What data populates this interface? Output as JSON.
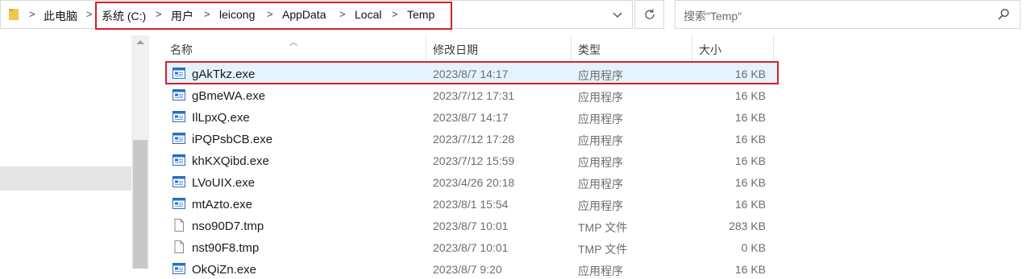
{
  "breadcrumb": {
    "items": [
      {
        "label": "此电脑"
      },
      {
        "label": "系统 (C:)"
      },
      {
        "label": "用户"
      },
      {
        "label": "leicong"
      },
      {
        "label": "AppData"
      },
      {
        "label": "Local"
      },
      {
        "label": "Temp"
      }
    ],
    "separator": ">"
  },
  "search": {
    "placeholder": "搜索\"Temp\""
  },
  "columns": {
    "name": "名称",
    "date": "修改日期",
    "type": "类型",
    "size": "大小"
  },
  "files": [
    {
      "name": "gAkTkz.exe",
      "date": "2023/8/7 14:17",
      "type": "应用程序",
      "size": "16 KB",
      "icon": "exe-icon",
      "selected": true
    },
    {
      "name": "gBmeWA.exe",
      "date": "2023/7/12 17:31",
      "type": "应用程序",
      "size": "16 KB",
      "icon": "exe-icon"
    },
    {
      "name": "IlLpxQ.exe",
      "date": "2023/8/7 14:17",
      "type": "应用程序",
      "size": "16 KB",
      "icon": "exe-icon"
    },
    {
      "name": "iPQPsbCB.exe",
      "date": "2023/7/12 17:28",
      "type": "应用程序",
      "size": "16 KB",
      "icon": "exe-icon"
    },
    {
      "name": "khKXQibd.exe",
      "date": "2023/7/12 15:59",
      "type": "应用程序",
      "size": "16 KB",
      "icon": "exe-icon"
    },
    {
      "name": "LVoUIX.exe",
      "date": "2023/4/26 20:18",
      "type": "应用程序",
      "size": "16 KB",
      "icon": "exe-icon"
    },
    {
      "name": "mtAzto.exe",
      "date": "2023/8/1 15:54",
      "type": "应用程序",
      "size": "16 KB",
      "icon": "exe-icon"
    },
    {
      "name": "nso90D7.tmp",
      "date": "2023/8/7 10:01",
      "type": "TMP 文件",
      "size": "283 KB",
      "icon": "document-icon"
    },
    {
      "name": "nst90F8.tmp",
      "date": "2023/8/7 10:01",
      "type": "TMP 文件",
      "size": "0 KB",
      "icon": "document-icon"
    },
    {
      "name": "OkQiZn.exe",
      "date": "2023/8/7 9:20",
      "type": "应用程序",
      "size": "16 KB",
      "icon": "exe-icon"
    }
  ],
  "colors": {
    "highlight_border": "#d91f26",
    "selection_bg": "#e5f3ff",
    "exe_icon_blue": "#1e6fd9"
  }
}
